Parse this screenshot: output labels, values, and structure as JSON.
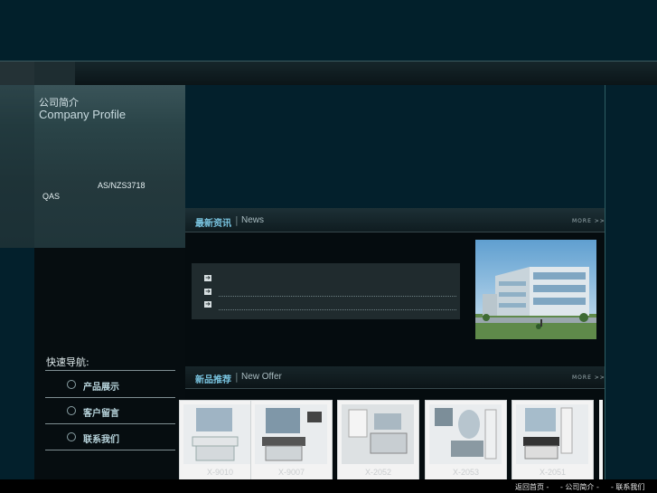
{
  "profile": {
    "title": "公司简介",
    "subtitle": "Company Profile",
    "cert": "AS/NZS3718",
    "qas": "QAS"
  },
  "quick_nav": {
    "title": "快速导航:",
    "items": [
      {
        "label": "产品展示"
      },
      {
        "label": "客户留言"
      },
      {
        "label": "联系我们"
      }
    ]
  },
  "news": {
    "title": "最新资讯",
    "separator": "|",
    "subtitle": "News",
    "more": "MORE >>"
  },
  "offer": {
    "title": "新品推荐",
    "separator": "|",
    "subtitle": "New Offer",
    "more": "MORE >>",
    "products": [
      {
        "code": "X-9010"
      },
      {
        "code": "X-9007"
      },
      {
        "code": "X-2052"
      },
      {
        "code": "X-2053"
      },
      {
        "code": "X-2051"
      }
    ]
  },
  "footer": {
    "links": [
      "返回首页 -",
      "- 公司简介 -",
      "- 联系我们"
    ]
  },
  "colors": {
    "page_bg": "#03202c",
    "accent": "#79c4e0",
    "panel": "#060d10"
  }
}
